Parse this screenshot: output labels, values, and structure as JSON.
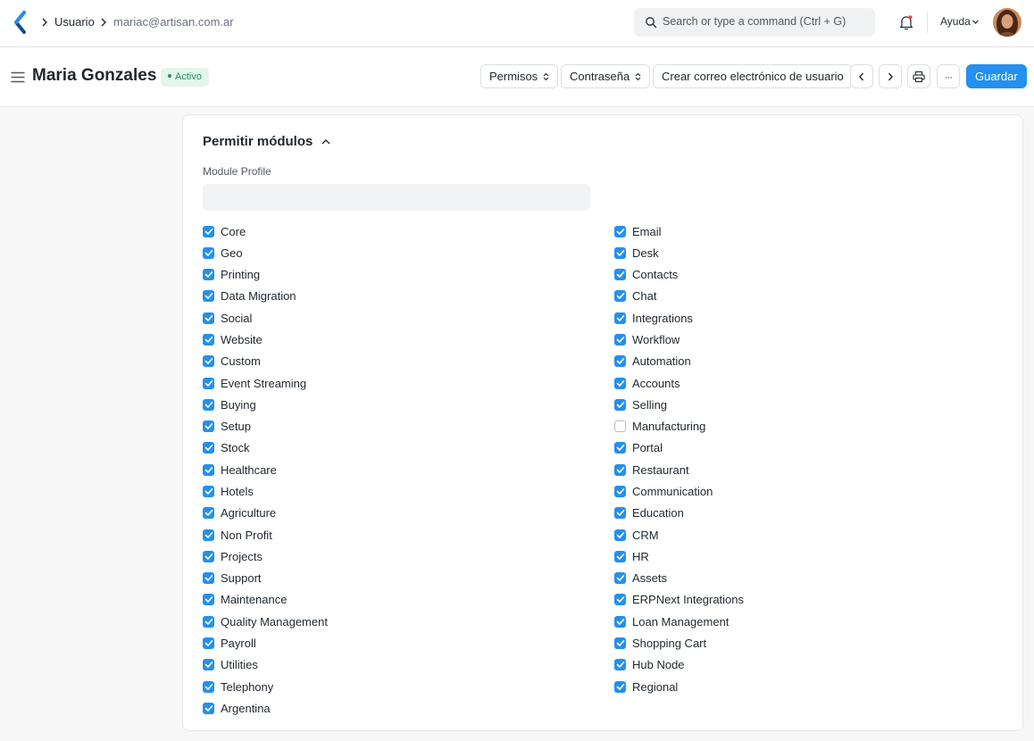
{
  "navbar": {
    "breadcrumbs": [
      "Usuario",
      "mariac@artisan.com.ar"
    ],
    "search_placeholder": "Search or type a command (Ctrl + G)",
    "help_label": "Ayuda"
  },
  "header": {
    "title": "Maria Gonzales",
    "status": "Activo",
    "buttons": {
      "permissions": "Permisos",
      "password": "Contraseña",
      "create_email": "Crear correo electrónico de usuario",
      "more": "···",
      "save": "Guardar"
    }
  },
  "section": {
    "title": "Permitir módulos",
    "module_profile_label": "Module Profile",
    "module_profile_value": ""
  },
  "modules_left": [
    {
      "label": "Core",
      "checked": true
    },
    {
      "label": "Geo",
      "checked": true
    },
    {
      "label": "Printing",
      "checked": true
    },
    {
      "label": "Data Migration",
      "checked": true
    },
    {
      "label": "Social",
      "checked": true
    },
    {
      "label": "Website",
      "checked": true
    },
    {
      "label": "Custom",
      "checked": true
    },
    {
      "label": "Event Streaming",
      "checked": true
    },
    {
      "label": "Buying",
      "checked": true
    },
    {
      "label": "Setup",
      "checked": true
    },
    {
      "label": "Stock",
      "checked": true
    },
    {
      "label": "Healthcare",
      "checked": true
    },
    {
      "label": "Hotels",
      "checked": true
    },
    {
      "label": "Agriculture",
      "checked": true
    },
    {
      "label": "Non Profit",
      "checked": true
    },
    {
      "label": "Projects",
      "checked": true
    },
    {
      "label": "Support",
      "checked": true
    },
    {
      "label": "Maintenance",
      "checked": true
    },
    {
      "label": "Quality Management",
      "checked": true
    },
    {
      "label": "Payroll",
      "checked": true
    },
    {
      "label": "Utilities",
      "checked": true
    },
    {
      "label": "Telephony",
      "checked": true
    },
    {
      "label": "Argentina",
      "checked": true
    }
  ],
  "modules_right": [
    {
      "label": "Email",
      "checked": true
    },
    {
      "label": "Desk",
      "checked": true
    },
    {
      "label": "Contacts",
      "checked": true
    },
    {
      "label": "Chat",
      "checked": true
    },
    {
      "label": "Integrations",
      "checked": true
    },
    {
      "label": "Workflow",
      "checked": true
    },
    {
      "label": "Automation",
      "checked": true
    },
    {
      "label": "Accounts",
      "checked": true
    },
    {
      "label": "Selling",
      "checked": true
    },
    {
      "label": "Manufacturing",
      "checked": false
    },
    {
      "label": "Portal",
      "checked": true
    },
    {
      "label": "Restaurant",
      "checked": true
    },
    {
      "label": "Communication",
      "checked": true
    },
    {
      "label": "Education",
      "checked": true
    },
    {
      "label": "CRM",
      "checked": true
    },
    {
      "label": "HR",
      "checked": true
    },
    {
      "label": "Assets",
      "checked": true
    },
    {
      "label": "ERPNext Integrations",
      "checked": true
    },
    {
      "label": "Loan Management",
      "checked": true
    },
    {
      "label": "Shopping Cart",
      "checked": true
    },
    {
      "label": "Hub Node",
      "checked": true
    },
    {
      "label": "Regional",
      "checked": true
    }
  ],
  "colors": {
    "primary": "#2490ef",
    "active_badge_bg": "#e4f5e9",
    "active_badge_text": "#278f5e"
  },
  "icons": [
    "frappe-logo-icon",
    "chevron-right-icon",
    "search-icon",
    "bell-icon",
    "chevron-down-icon",
    "avatar",
    "hamburger-icon",
    "sort-icon",
    "chevron-left-icon",
    "printer-icon",
    "chevron-up-icon",
    "checkbox-checked-icon"
  ]
}
